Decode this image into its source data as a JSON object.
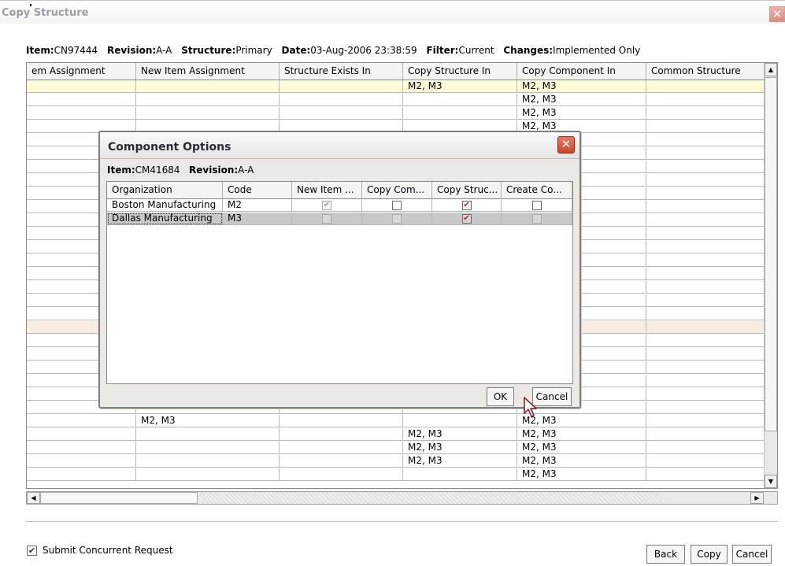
{
  "window": {
    "title": "Copy Structure",
    "close_glyph": "✕"
  },
  "info": {
    "item_label": "Item:",
    "item": "CN97444",
    "revision_label": "Revision:",
    "revision": "A-A",
    "structure_label": "Structure:",
    "structure": "Primary",
    "date_label": "Date:",
    "date": "03-Aug-2006 23:38:59",
    "filter_label": "Filter:",
    "filter": "Current",
    "changes_label": "Changes:",
    "changes": "Implemented Only"
  },
  "table": {
    "columns": [
      "em Assignment",
      "New Item Assignment",
      "Structure Exists In",
      "Copy Structure In",
      "Copy Component In",
      "Common Structure"
    ],
    "rows": [
      [
        "",
        "",
        "",
        "M2, M3",
        "M2, M3",
        ""
      ],
      [
        "",
        "",
        "",
        "",
        "M2, M3",
        ""
      ],
      [
        "",
        "",
        "",
        "",
        "M2, M3",
        ""
      ],
      [
        "",
        "",
        "",
        "",
        "M2, M3",
        ""
      ],
      [
        "",
        "",
        "",
        "",
        "",
        ""
      ],
      [
        "",
        "",
        "",
        "",
        "",
        ""
      ],
      [
        "",
        "",
        "",
        "",
        "",
        ""
      ],
      [
        "",
        "",
        "",
        "",
        "",
        ""
      ],
      [
        "",
        "",
        "",
        "",
        "",
        ""
      ],
      [
        "",
        "",
        "",
        "",
        "",
        ""
      ],
      [
        "",
        "",
        "",
        "",
        "",
        ""
      ],
      [
        "",
        "",
        "",
        "",
        "",
        ""
      ],
      [
        "",
        "",
        "",
        "",
        "",
        ""
      ],
      [
        "",
        "",
        "",
        "",
        "",
        ""
      ],
      [
        "",
        "",
        "",
        "",
        "",
        ""
      ],
      [
        "",
        "",
        "",
        "",
        "",
        ""
      ],
      [
        "",
        "",
        "",
        "",
        "",
        ""
      ],
      [
        "",
        "",
        "",
        "",
        "",
        ""
      ],
      [
        "",
        "",
        "",
        "",
        "",
        ""
      ],
      [
        "",
        "",
        "",
        "",
        "",
        ""
      ],
      [
        "",
        "",
        "",
        "",
        "",
        ""
      ],
      [
        "",
        "",
        "",
        "",
        "",
        ""
      ],
      [
        "",
        "",
        "",
        "",
        "",
        ""
      ],
      [
        "",
        "",
        "",
        "",
        "",
        ""
      ],
      [
        "",
        "",
        "",
        "",
        "",
        ""
      ],
      [
        "",
        "M2, M3",
        "",
        "",
        "M2, M3",
        ""
      ],
      [
        "",
        "",
        "",
        "M2, M3",
        "M2, M3",
        ""
      ],
      [
        "",
        "",
        "",
        "M2, M3",
        "M2, M3",
        ""
      ],
      [
        "",
        "",
        "",
        "M2, M3",
        "M2, M3",
        ""
      ],
      [
        "",
        "",
        "",
        "",
        "M2, M3",
        ""
      ]
    ]
  },
  "dialog": {
    "title": "Component Options",
    "close_glyph": "✕",
    "item_label": "Item:",
    "item": "CM41684",
    "revision_label": "Revision:",
    "revision": "A-A",
    "columns": [
      "Organization",
      "Code",
      "New Item ...",
      "Copy Com...",
      "Copy Struc...",
      "Create Co..."
    ],
    "rows": [
      {
        "organization": "Boston Manufacturing",
        "code": "M2",
        "new_item": true,
        "copy_component": false,
        "copy_structure": true,
        "create_common": false
      },
      {
        "organization": "Dallas Manufacturing",
        "code": "M3",
        "new_item": false,
        "copy_component": false,
        "copy_structure": true,
        "create_common": false
      }
    ],
    "ok_label": "OK",
    "cancel_label": "Cancel"
  },
  "footer": {
    "submit_label": "Submit Concurrent Request",
    "submit_checked": true,
    "back_label": "Back",
    "copy_label": "Copy",
    "cancel_label": "Cancel"
  },
  "scroll": {
    "up_glyph": "▲",
    "down_glyph": "▼",
    "left_glyph": "◀",
    "right_glyph": "▶"
  },
  "check_glyph": "✔"
}
